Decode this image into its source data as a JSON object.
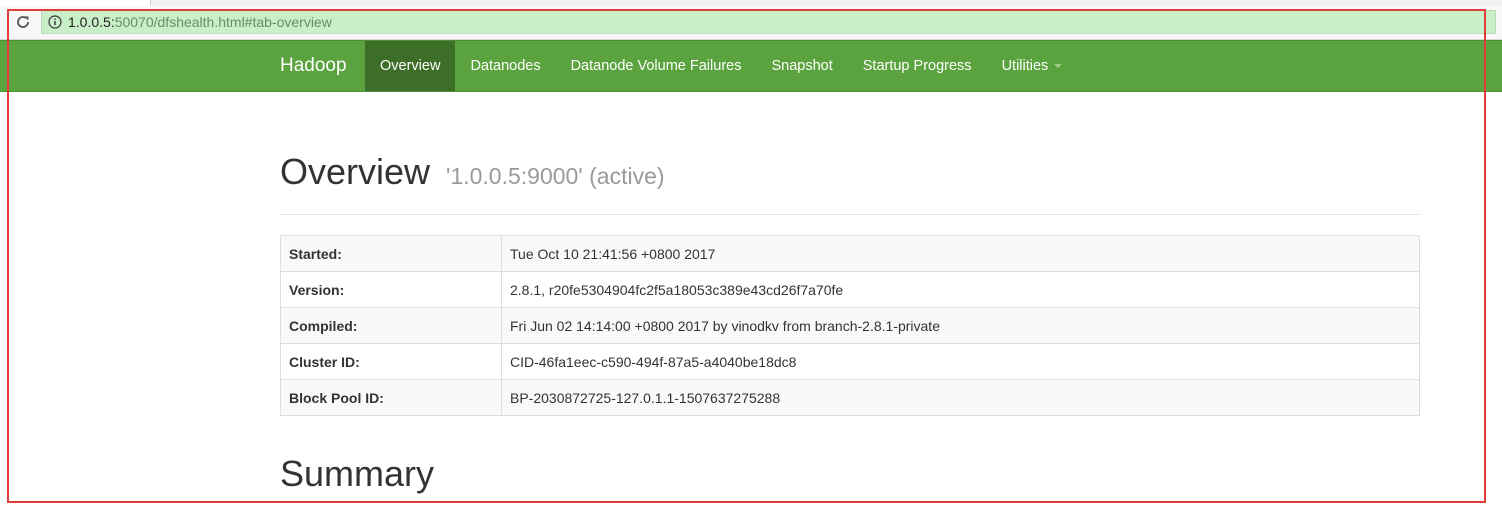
{
  "browser": {
    "url_host": "1.0.0.5:",
    "url_rest": "50070/dfshealth.html#tab-overview"
  },
  "navbar": {
    "brand": "Hadoop",
    "items": [
      {
        "label": "Overview",
        "active": true
      },
      {
        "label": "Datanodes"
      },
      {
        "label": "Datanode Volume Failures"
      },
      {
        "label": "Snapshot"
      },
      {
        "label": "Startup Progress"
      },
      {
        "label": "Utilities"
      }
    ],
    "color": "#5aa33e",
    "active_color": "#3c6e28"
  },
  "overview": {
    "title": "Overview",
    "subtitle": "'1.0.0.5:9000' (active)",
    "rows": [
      {
        "key": "Started:",
        "value": "Tue Oct 10 21:41:56 +0800 2017"
      },
      {
        "key": "Version:",
        "value": "2.8.1, r20fe5304904fc2f5a18053c389e43cd26f7a70fe"
      },
      {
        "key": "Compiled:",
        "value": "Fri Jun 02 14:14:00 +0800 2017 by vinodkv from branch-2.8.1-private"
      },
      {
        "key": "Cluster ID:",
        "value": "CID-46fa1eec-c590-494f-87a5-a4040be18dc8"
      },
      {
        "key": "Block Pool ID:",
        "value": "BP-2030872725-127.0.1.1-1507637275288"
      }
    ]
  },
  "summary": {
    "title": "Summary"
  },
  "annotation": {
    "color": "#e03c3c"
  }
}
